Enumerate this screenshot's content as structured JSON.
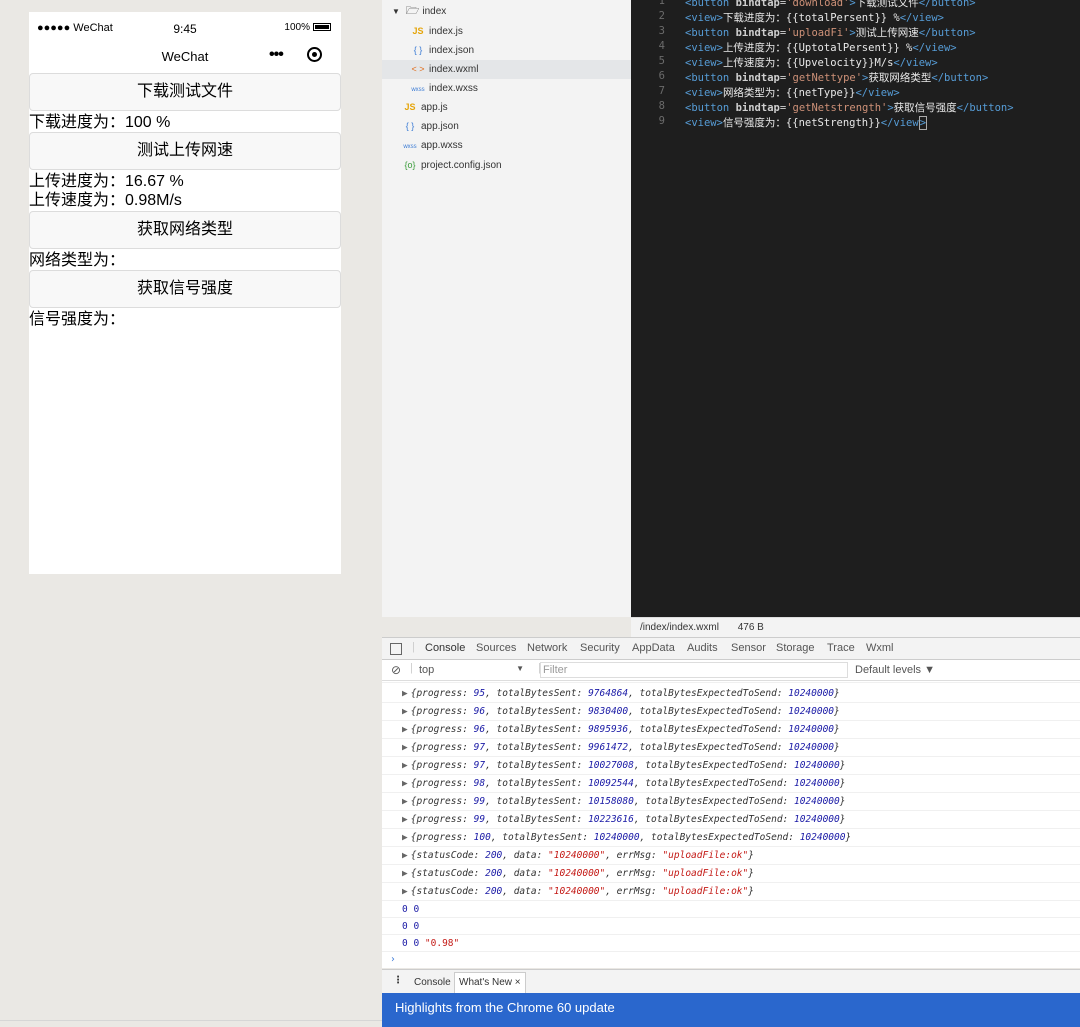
{
  "simulator": {
    "carrier": "●●●●● WeChat",
    "time": "9:45",
    "battery_pct": "100%",
    "nav_title": "WeChat",
    "nav_menu": "•••",
    "buttons": [
      "下载测试文件",
      "测试上传网速",
      "获取网络类型",
      "获取信号强度"
    ],
    "texts": [
      "下载进度为：100 %",
      "上传进度为：16.67 %",
      "上传速度为：0.98M/s",
      "网络类型为：",
      "信号强度为："
    ]
  },
  "explorer": {
    "folder": "index",
    "files": [
      {
        "icon": "JS",
        "name": "index.js",
        "type": "js"
      },
      {
        "icon": "{ }",
        "name": "index.json",
        "type": "json"
      },
      {
        "icon": "< >",
        "name": "index.wxml",
        "type": "wxml"
      },
      {
        "icon": "wxss",
        "name": "index.wxss",
        "type": "wxss"
      },
      {
        "icon": "JS",
        "name": "app.js",
        "type": "js"
      },
      {
        "icon": "{ }",
        "name": "app.json",
        "type": "json"
      },
      {
        "icon": "wxss",
        "name": "app.wxss",
        "type": "wxss"
      },
      {
        "icon": "{o}",
        "name": "project.config.json",
        "type": "cfg"
      }
    ]
  },
  "editor": {
    "line_numbers": [
      "1",
      "2",
      "3",
      "4",
      "5",
      "6",
      "7",
      "8",
      "9"
    ],
    "file_path": "/index/index.wxml",
    "file_size": "476 B"
  },
  "devtools": {
    "tabs": [
      "Console",
      "Sources",
      "Network",
      "Security",
      "AppData",
      "Audits",
      "Sensor",
      "Storage",
      "Trace",
      "Wxml"
    ],
    "context": "top",
    "filter_placeholder": "Filter",
    "levels": "Default levels ▼",
    "progress_rows": [
      {
        "progress": "95",
        "sent": "9764864",
        "expected": "10240000"
      },
      {
        "progress": "96",
        "sent": "9830400",
        "expected": "10240000"
      },
      {
        "progress": "96",
        "sent": "9895936",
        "expected": "10240000"
      },
      {
        "progress": "97",
        "sent": "9961472",
        "expected": "10240000"
      },
      {
        "progress": "97",
        "sent": "10027008",
        "expected": "10240000"
      },
      {
        "progress": "98",
        "sent": "10092544",
        "expected": "10240000"
      },
      {
        "progress": "99",
        "sent": "10158080",
        "expected": "10240000"
      },
      {
        "progress": "99",
        "sent": "10223616",
        "expected": "10240000"
      },
      {
        "progress": "100",
        "sent": "10240000",
        "expected": "10240000"
      }
    ],
    "status_rows": [
      {
        "code": "200",
        "data": "\"10240000\"",
        "msg": "\"uploadFile:ok\""
      },
      {
        "code": "200",
        "data": "\"10240000\"",
        "msg": "\"uploadFile:ok\""
      },
      {
        "code": "200",
        "data": "\"10240000\"",
        "msg": "\"uploadFile:ok\""
      }
    ],
    "plain_rows": [
      "0 0",
      "0 0",
      "0 0"
    ],
    "last_value": "\"0.98\"",
    "prompt": "›",
    "drawer_tabs": [
      "Console",
      "What's New ×"
    ],
    "banner": "Highlights from the Chrome 60 update"
  }
}
